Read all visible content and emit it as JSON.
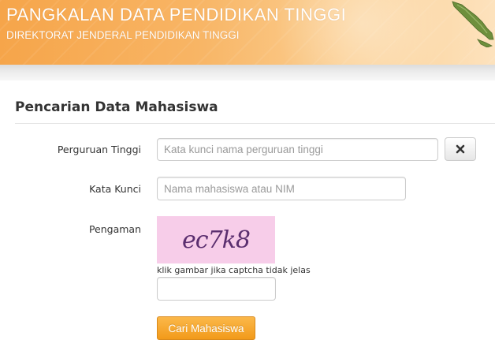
{
  "header": {
    "title": "PANGKALAN DATA PENDIDIKAN TINGGI",
    "subtitle": "DIREKTORAT JENDERAL PENDIDIKAN TINGGI"
  },
  "form": {
    "heading": "Pencarian Data Mahasiswa",
    "university": {
      "label": "Perguruan Tinggi",
      "placeholder": "Kata kunci nama perguruan tinggi",
      "value": ""
    },
    "clear_icon": "close-icon",
    "keyword": {
      "label": "Kata Kunci",
      "placeholder": "Nama mahasiswa atau NIM",
      "value": ""
    },
    "security": {
      "label": "Pengaman",
      "captcha_text": "ec7k8",
      "hint": "klik gambar jika captcha tidak jelas",
      "value": ""
    },
    "submit_label": "Cari Mahasiswa"
  },
  "colors": {
    "banner": "#f6a54a",
    "submit": "#f29a1a",
    "captcha_bg": "#f7cde9"
  }
}
